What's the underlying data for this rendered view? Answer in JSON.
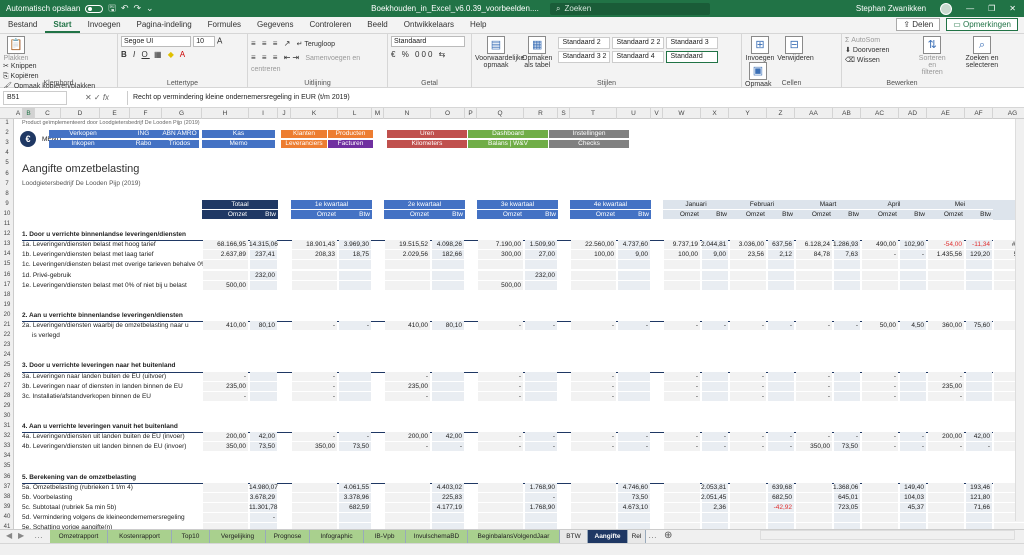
{
  "titlebar": {
    "autosave": "Automatisch opslaan",
    "filename": "Boekhouden_in_Excel_v6.0.39_voorbeelden....",
    "search": "Zoeken",
    "user": "Stephan Zwanikken"
  },
  "ribbon_tabs": [
    "Bestand",
    "Start",
    "Invoegen",
    "Pagina-indeling",
    "Formules",
    "Gegevens",
    "Controleren",
    "Beeld",
    "Ontwikkelaars",
    "Help"
  ],
  "share_label": "Delen",
  "comments_label": "Opmerkingen",
  "ribbon": {
    "clipboard": {
      "paste": "Plakken",
      "cut": "Knippen",
      "copy": "Kopiëren",
      "format_painter": "Opmaak kopiëren/plakken",
      "label": "Klembord"
    },
    "font": {
      "name": "Segoe UI",
      "size": "10",
      "label": "Lettertype"
    },
    "alignment": {
      "wrap": "Terugloop",
      "merge": "Samenvoegen en centreren",
      "label": "Uitlijning"
    },
    "number": {
      "format": "Standaard",
      "label": "Getal"
    },
    "styles": {
      "conditional": "Voorwaardelijke opmaak",
      "as_table": "Opmaken als tabel",
      "items": [
        "Standaard 2",
        "Standaard 2 2",
        "Standaard 3",
        "Standaard 3 2",
        "Standaard 4",
        "Standaard"
      ],
      "label": "Stijlen"
    },
    "cells": {
      "insert": "Invoegen",
      "delete": "Verwijderen",
      "format": "Opmaak",
      "label": "Cellen"
    },
    "editing": {
      "autosum": "AutoSom",
      "fill": "Doorvoeren",
      "clear": "Wissen",
      "sort": "Sorteren en filteren",
      "find": "Zoeken en selecteren",
      "label": "Bewerken"
    }
  },
  "formula_bar": {
    "cell": "B51",
    "fx": "fx",
    "formula": "Recht op vermindering kleine ondernemersregeling in EUR (t/m 2019)"
  },
  "columns": [
    "A",
    "B",
    "C",
    "D",
    "E",
    "F",
    "G",
    "H",
    "I",
    "J",
    "K",
    "L",
    "M",
    "N",
    "O",
    "P",
    "Q",
    "R",
    "S",
    "T",
    "U",
    "V",
    "W",
    "X",
    "Y",
    "Z",
    "AA",
    "AB",
    "AC",
    "AD",
    "AE",
    "AF",
    "AG"
  ],
  "rows": [
    "1",
    "2",
    "3",
    "4",
    "5",
    "6",
    "7",
    "8",
    "9",
    "10",
    "11",
    "12",
    "13",
    "14",
    "15",
    "16",
    "17",
    "18",
    "19",
    "20",
    "21",
    "22",
    "23",
    "24",
    "25",
    "26",
    "27",
    "28",
    "29",
    "30",
    "31",
    "32",
    "33",
    "34",
    "35",
    "36",
    "37",
    "38",
    "39",
    "40",
    "41"
  ],
  "header_text": "Product geïmplementeerd door Loodgietersbedrijf De Looden Pijp (2019)",
  "menu_label": "MENU",
  "nav": [
    {
      "label": "Verkopen",
      "color": "#4472c4"
    },
    {
      "label": "ING",
      "color": "#4472c4"
    },
    {
      "label": "ABN AMRO",
      "color": "#4472c4"
    },
    {
      "label": "Kas",
      "color": "#4472c4"
    },
    {
      "label": "Inkopen",
      "color": "#4472c4"
    },
    {
      "label": "Rabo",
      "color": "#4472c4"
    },
    {
      "label": "Triodos",
      "color": "#4472c4"
    },
    {
      "label": "Memo",
      "color": "#4472c4"
    },
    {
      "label": "Klanten",
      "color": "#ed7d31"
    },
    {
      "label": "Producten",
      "color": "#ed7d31"
    },
    {
      "label": "Leveranciers",
      "color": "#ed7d31"
    },
    {
      "label": "Facturen",
      "color": "#7030a0"
    },
    {
      "label": "Uren",
      "color": "#c0504d"
    },
    {
      "label": "Kilometers",
      "color": "#c0504d"
    },
    {
      "label": "Dashboard",
      "color": "#70ad47"
    },
    {
      "label": "Balans | W&V",
      "color": "#70ad47"
    },
    {
      "label": "Instellingen",
      "color": "#808080"
    },
    {
      "label": "Checks",
      "color": "#808080"
    }
  ],
  "sheet_title": "Aangifte omzetbelasting",
  "company": "Loodgietersbedrijf De Looden Pijp (2019)",
  "period_headers": [
    "Totaal",
    "1e kwartaal",
    "2e kwartaal",
    "3e kwartaal",
    "4e kwartaal",
    "Januari",
    "Februari",
    "Maart",
    "April",
    "Mei"
  ],
  "sub_headers": {
    "omzet": "Omzet",
    "btw": "Btw"
  },
  "sections": [
    "1. Door u verrichte binnenlandse leveringen/diensten",
    "2. Aan u verrichte binnenlandse leveringen/diensten",
    "3. Door u verrichte leveringen naar het buitenland",
    "4. Aan u verrichte leveringen vanuit het buitenland",
    "5. Berekening van de omzetbelasting"
  ],
  "table_rows": [
    {
      "label": "1a. Leveringen/diensten belast met hoog tarief",
      "vals": [
        "68.166,95",
        "14.315,06",
        "18.901,43",
        "3.969,30",
        "19.515,52",
        "4.098,26",
        "7.190,00",
        "1.509,90",
        "22.560,00",
        "4.737,60",
        "9.737,19",
        "2.044,81",
        "3.036,00",
        "637,56",
        "6.128,24",
        "1.286,93",
        "490,00",
        "102,90",
        "-54,00",
        "-11,34",
        "#####"
      ]
    },
    {
      "label": "1b. Leveringen/diensten belast met laag tarief",
      "vals": [
        "2.637,89",
        "237,41",
        "208,33",
        "18,75",
        "2.029,56",
        "182,66",
        "300,00",
        "27,00",
        "100,00",
        "9,00",
        "100,00",
        "9,00",
        "23,56",
        "2,12",
        "84,78",
        "7,63",
        "-",
        "-",
        "1.435,56",
        "129,20",
        "594,0"
      ]
    },
    {
      "label": "1c. Leveringen/diensten belast met overige tarieven behalve 0%",
      "vals": [
        "",
        "",
        "",
        "",
        "",
        "",
        "",
        "",
        "",
        "",
        "",
        "",
        "",
        "",
        "",
        "",
        "",
        "",
        "",
        "",
        ""
      ]
    },
    {
      "label": "1d. Privé-gebruik",
      "vals": [
        "",
        "232,00",
        "",
        "",
        "",
        "",
        "",
        "232,00",
        "",
        "",
        "",
        "",
        "",
        "",
        "",
        "",
        "",
        "",
        "",
        "",
        ""
      ]
    },
    {
      "label": "1e. Leveringen/diensten belast met 0% of niet bij u belast",
      "vals": [
        "500,00",
        "",
        "",
        "",
        "",
        "",
        "500,00",
        "",
        "",
        "",
        "",
        "",
        "",
        "",
        "",
        "",
        "",
        "",
        "",
        "",
        ""
      ]
    },
    {
      "label": "2a. Leveringen/diensten waarbij de omzetbelasting naar u",
      "label2": "is verlegd",
      "vals": [
        "410,00",
        "80,10",
        "-",
        "-",
        "410,00",
        "80,10",
        "-",
        "-",
        "-",
        "-",
        "-",
        "-",
        "-",
        "-",
        "-",
        "-",
        "50,00",
        "4,50",
        "360,00",
        "75,60",
        "-"
      ]
    },
    {
      "label": "3a. Leveringen naar landen buiten de EU (uitvoer)",
      "vals": [
        "-",
        "",
        "-",
        "",
        "-",
        "",
        "-",
        "",
        "-",
        "",
        "-",
        "",
        "-",
        "",
        "-",
        "",
        "-",
        "",
        "-",
        "",
        ""
      ]
    },
    {
      "label": "3b. Leveringen naar of diensten in landen binnen de EU",
      "vals": [
        "235,00",
        "",
        "-",
        "",
        "235,00",
        "",
        "-",
        "",
        "-",
        "",
        "-",
        "",
        "-",
        "",
        "-",
        "",
        "-",
        "",
        "235,00",
        "",
        ""
      ]
    },
    {
      "label": "3c. Installatie/afstandverkopen binnen de EU",
      "vals": [
        "-",
        "",
        "-",
        "",
        "-",
        "",
        "-",
        "",
        "-",
        "",
        "-",
        "",
        "-",
        "",
        "-",
        "",
        "-",
        "",
        "-",
        "",
        ""
      ]
    },
    {
      "label": "4a. Leveringen/diensten uit landen buiten de EU (invoer)",
      "vals": [
        "200,00",
        "42,00",
        "-",
        "-",
        "200,00",
        "42,00",
        "-",
        "-",
        "-",
        "-",
        "-",
        "-",
        "-",
        "-",
        "-",
        "-",
        "-",
        "-",
        "200,00",
        "42,00",
        "-"
      ]
    },
    {
      "label": "4b. Leveringen/diensten uit landen binnen de EU (invoer)",
      "vals": [
        "350,00",
        "73,50",
        "350,00",
        "73,50",
        "-",
        "-",
        "-",
        "-",
        "-",
        "-",
        "-",
        "-",
        "-",
        "-",
        "350,00",
        "73,50",
        "-",
        "-",
        "-",
        "-",
        "-"
      ]
    },
    {
      "label": "5a. Omzetbelasting (rubrieken 1 t/m 4)",
      "vals": [
        "",
        "14.980,07",
        "",
        "4.061,55",
        "",
        "4.403,02",
        "",
        "1.768,90",
        "",
        "4.746,60",
        "",
        "2.053,81",
        "",
        "639,68",
        "",
        "1.368,06",
        "",
        "149,40",
        "",
        "193,46",
        ""
      ]
    },
    {
      "label": "5b. Voorbelasting",
      "vals": [
        "",
        "3.678,29",
        "",
        "3.378,96",
        "",
        "225,83",
        "",
        "-",
        "",
        "73,50",
        "",
        "2.051,45",
        "",
        "682,50",
        "",
        "645,01",
        "",
        "104,03",
        "",
        "121,80",
        ""
      ]
    },
    {
      "label": "5c. Subtotaal (rubriek 5a min 5b)",
      "vals": [
        "",
        "11.301,78",
        "",
        "682,59",
        "",
        "4.177,19",
        "",
        "1.768,90",
        "",
        "4.673,10",
        "",
        "2,36",
        "",
        "-42,92",
        "",
        "723,05",
        "",
        "45,37",
        "",
        "71,66",
        ""
      ]
    },
    {
      "label": "5d. Vermindering volgens de kleineondernemersregeling",
      "vals": [
        "",
        "-",
        "",
        "",
        "",
        "",
        "",
        "",
        "",
        "",
        "",
        "",
        "",
        "",
        "",
        "",
        "",
        "",
        "",
        "",
        ""
      ]
    },
    {
      "label": "5e. Schatting vorige aangifte(n)",
      "vals": [
        "",
        "",
        "",
        "",
        "",
        "",
        "",
        "",
        "",
        "",
        "",
        "",
        "",
        "",
        "",
        "",
        "",
        "",
        "",
        "",
        ""
      ]
    }
  ],
  "sheet_tabs": [
    "Omzetrapport",
    "Kostenrapport",
    "Top10",
    "Vergelijking",
    "Prognose",
    "Infographic",
    "IB-Vpb",
    "InvulschemaBD",
    "BeginbalansVolgendJaar",
    "BTW",
    "Aangifte",
    "Rel"
  ],
  "colors": {
    "excel_green": "#217346",
    "navy": "#1f3864",
    "blue": "#4472c4",
    "negative": "#e03030"
  }
}
